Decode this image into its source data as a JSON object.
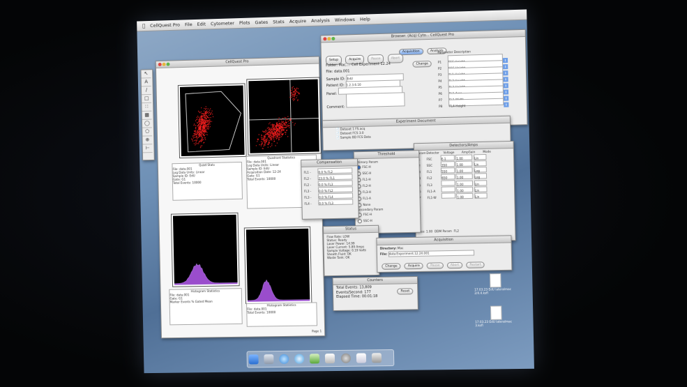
{
  "menubar": {
    "apple": "",
    "items": [
      "CellQuest Pro",
      "File",
      "Edit",
      "Cytometer",
      "Plots",
      "Gates",
      "Stats",
      "Acquire",
      "Analysis",
      "Windows",
      "Help"
    ]
  },
  "browser": {
    "title": "Browser: (Acq) Cyto... CellQuest Pro",
    "tab_acquisition": "Acquisition",
    "tab_analysis": "Analysis",
    "buttons": {
      "setup": "Setup",
      "acquire": "Acquire",
      "pause": "Pause",
      "abort": "Abort",
      "change": "Change"
    },
    "labels": {
      "folder": "Folder:",
      "file": "File:",
      "sample_id": "Sample ID:",
      "patient_id": "Patient ID:",
      "panel": "Panel:",
      "comment": "Comment:"
    },
    "values": {
      "folder": "Mac...: Cell Experiment 12.24",
      "file": "data.001",
      "sample_id": "EdU",
      "patient_id": "1.2.3.6.10",
      "panel": "",
      "comment": ""
    },
    "params_header": "Parameter Description",
    "params": [
      {
        "name": "P1",
        "value": "FSC-Height"
      },
      {
        "name": "P2",
        "value": "SSC-Height"
      },
      {
        "name": "P3",
        "value": "FL1-Height"
      },
      {
        "name": "P4",
        "value": "FL2-Height"
      },
      {
        "name": "P5",
        "value": "FL3-Height"
      },
      {
        "name": "P6",
        "value": "FL1-Area"
      },
      {
        "name": "P7",
        "value": "FL1-Width"
      },
      {
        "name": "P8",
        "value": "FL4-Height"
      }
    ],
    "footer": "Browser"
  },
  "exp_doc": {
    "title": "Experiment Document",
    "files": [
      "Dataset 1 FS.acq",
      "Dataset FCS 3.0",
      "Sample BD FCS Data"
    ]
  },
  "detectors": {
    "title": "Detectors/Amps",
    "header": [
      "Param",
      "Detector",
      "Voltage",
      "AmpGain",
      "Mode"
    ],
    "rows": [
      {
        "p": "P1",
        "d": "FSC",
        "v": "E-1",
        "g": "1.00",
        "m": "Lin"
      },
      {
        "p": "P2",
        "d": "SSC",
        "v": "350",
        "g": "1.00",
        "m": "Lin"
      },
      {
        "p": "P3",
        "d": "FL1",
        "v": "550",
        "g": "1.00",
        "m": "Log"
      },
      {
        "p": "P4",
        "d": "FL2",
        "v": "650",
        "g": "1.00",
        "m": "Log"
      },
      {
        "p": "P5",
        "d": "FL3",
        "v": "",
        "g": "1.00",
        "m": "Lin"
      },
      {
        "p": "P6",
        "d": "FL1-A",
        "v": "",
        "g": "1.00",
        "m": "Lin"
      },
      {
        "p": "P7",
        "d": "FL1-W",
        "v": "",
        "g": "1.00",
        "m": "Lin"
      }
    ],
    "footer_left": "Pico: 1.00",
    "footer_mid": "DDM Param",
    "footer_right": "FL2",
    "footer_bottom": "Mode: FSC, FSC, 1.00"
  },
  "threshold": {
    "title": "Threshold",
    "col1": "Primary Param",
    "col2": "Secondary Param",
    "items": [
      "FSC-H",
      "SSC-H",
      "FL1-H",
      "FL2-H",
      "FL3-H",
      "FL1-A",
      "None"
    ],
    "selected": "None"
  },
  "compensation": {
    "title": "Compensation",
    "rows": [
      {
        "name": "FL1 -",
        "value": "0.0 % FL2"
      },
      {
        "name": "FL2 -",
        "value": "23.0 % FL1"
      },
      {
        "name": "FL2 -",
        "value": "0.0 % FL3"
      },
      {
        "name": "FL3 -",
        "value": "0.0 % FL2"
      },
      {
        "name": "FL3 -",
        "value": "0.0 % FL4"
      },
      {
        "name": "FL4 -",
        "value": "0.0 % FL3"
      }
    ]
  },
  "status": {
    "title": "Status",
    "lines": [
      "Flow Rate: LOW",
      "Status: Ready",
      "Laser Power: 14.99",
      "Laser Current: 5.89 Amps",
      "Sample Voltage: 0.19 Volts",
      "Sheath Fluid: OK",
      "Waste Tank: OK"
    ]
  },
  "counters": {
    "title": "Counters",
    "total_events": "Total Events: 13,809",
    "events_per_sec": "Events/Second: 177",
    "elapsed": "Elapsed Time: 00:01:18",
    "reset": "Reset"
  },
  "acq_dialog": {
    "title": "Acquisition",
    "labels": {
      "directory": "Directory:",
      "file": "File:"
    },
    "values": {
      "directory": "Mac",
      "file": "data:Experiment.12.24.001"
    },
    "buttons": [
      "Change",
      "Acquire",
      "Pause",
      "Abort",
      "Restart"
    ]
  },
  "cellquest_doc": {
    "title": "CellQuest Pro",
    "stats1_title": "Quad Stats",
    "stats2_title": "Quadrant Statistics",
    "stats3_title": "Histogram Statistics",
    "stats4_title": "Histogram Statistics",
    "page_label": "Page 1",
    "stat_lines": [
      "File: data.001",
      "Log Data Units: Linear",
      "Sample ID: EdU",
      "Acquisition Date: 12-24",
      "Gate: G1",
      "Total Events: 10000"
    ],
    "hist_lines": [
      "Marker",
      "Events",
      "% Gated",
      "Mean",
      "Median"
    ]
  },
  "desktop": {
    "icon1": "17.03.23 EdU lateralmac",
    "icon1_sub": "2/4.4.ksfl",
    "icon2": "17.03.23 EdU lateralmac",
    "icon2_sub": "3.ksfl"
  },
  "colors": {
    "dots": "#ff2020",
    "histogram": "#9a4dcc",
    "desktop": "#6d8fb5"
  }
}
